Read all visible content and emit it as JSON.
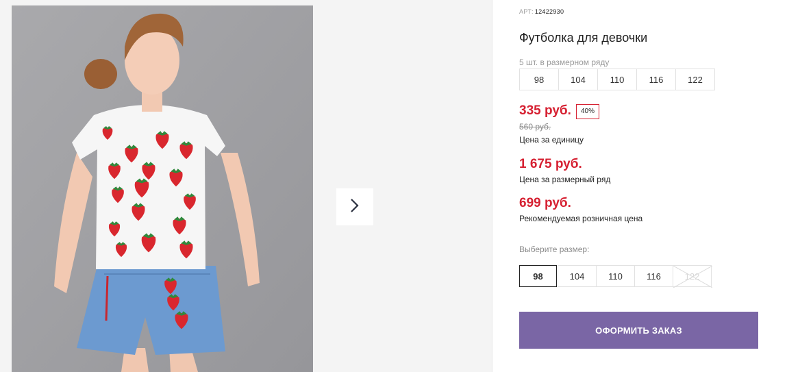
{
  "gallery": {
    "image_alt": "Девочка в футболке с клубничным принтом",
    "next_icon": "chevron-right-icon"
  },
  "product": {
    "art_label": "АРТ:",
    "art_value": "12422930",
    "title": "Футболка для девочки",
    "row_count_text": "5 шт. в размерном ряду",
    "row_sizes": [
      "98",
      "104",
      "110",
      "116",
      "122"
    ],
    "price_unit": "335 руб.",
    "discount_badge": "40%",
    "old_price": "560 руб.",
    "price_unit_label": "Цена за единицу",
    "price_row": "1 675 руб.",
    "price_row_label": "Цена за размерный ряд",
    "price_retail": "699 руб.",
    "price_retail_label": "Рекомендуемая розничная цена",
    "choose_size_label": "Выберите размер:",
    "select_sizes": [
      {
        "label": "98",
        "state": "selected"
      },
      {
        "label": "104",
        "state": "available"
      },
      {
        "label": "110",
        "state": "available"
      },
      {
        "label": "116",
        "state": "available"
      },
      {
        "label": "122",
        "state": "disabled"
      }
    ],
    "order_button": "ОФОРМИТЬ ЗАКАЗ"
  },
  "colors": {
    "price": "#d62132",
    "button": "#7a66a5",
    "gallery_bg": "#f4f4f4"
  }
}
